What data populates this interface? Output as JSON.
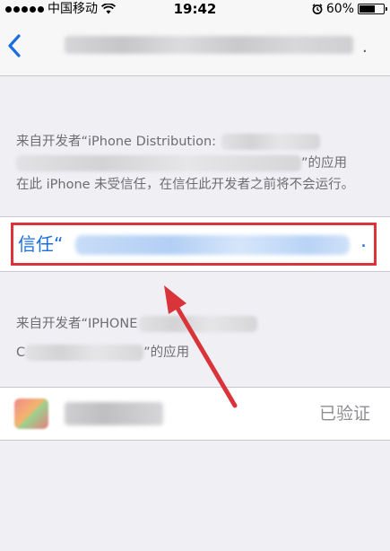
{
  "status_bar": {
    "carrier": "中国移动",
    "time": "19:42",
    "battery": "60%",
    "battery_level": 0.6
  },
  "nav": {
    "back_icon": "chevron-left-icon"
  },
  "developer_section_1": {
    "line_prefix": "来自开发者“iPhone Distribution:",
    "line_suffix": "”的应用",
    "line_rest": "在此 iPhone 未受信任，在信任此开发者之前将不会运行。"
  },
  "trust_button": {
    "label": "信任“",
    "trailing": "."
  },
  "developer_section_2": {
    "line_prefix": "来自开发者“IPHONE",
    "line_start": "C",
    "line_suffix": "”的应用"
  },
  "app_row": {
    "status": "已验证"
  },
  "colors": {
    "accent_blue": "#1a6ee0",
    "highlight_red": "#d8343a",
    "background": "#efeff4"
  }
}
